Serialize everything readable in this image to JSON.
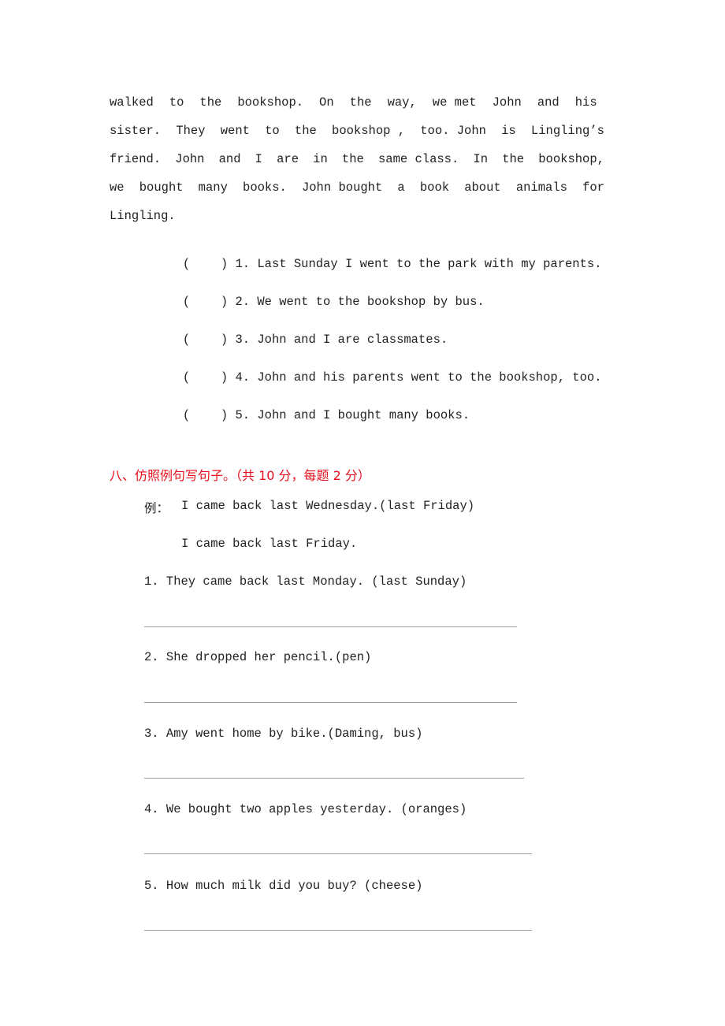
{
  "passage": {
    "lines": [
      [
        "walked",
        "to",
        "the",
        "bookshop.",
        "On",
        "the",
        "way,",
        "we met",
        "John",
        "and",
        "his "
      ],
      [
        "sister.",
        "They",
        "went",
        "to",
        "the",
        "bookshop ,",
        "too. John",
        "is",
        "Lingling’s"
      ],
      [
        "friend.",
        "John",
        "and",
        "I",
        "are",
        "in",
        "the",
        "same class.",
        "In",
        "the",
        "bookshop,"
      ],
      [
        "we",
        "bought",
        "many",
        "books.",
        "John bought",
        "a",
        "book",
        "about",
        "animals",
        "for"
      ]
    ],
    "last_line": "Lingling."
  },
  "true_false": {
    "items": [
      {
        "blank": "(",
        "close": ")",
        "text": "1. Last Sunday I went to the park with my parents."
      },
      {
        "blank": "(",
        "close": ")",
        "text": "2. We went to the bookshop by bus."
      },
      {
        "blank": "(",
        "close": ")",
        "text": "3. John and I are classmates."
      },
      {
        "blank": "(",
        "close": ")",
        "text": "4. John and his parents went to the bookshop, too."
      },
      {
        "blank": "(",
        "close": ")",
        "text": "5. John and I bought many books."
      }
    ]
  },
  "section8": {
    "heading": "八、仿照例句写句子。（共 10 分，每题 2 分）",
    "heading_color": "#e8101c",
    "example_label": "例：",
    "example_sentence": "I came back last Wednesday.(last Friday)",
    "example_answer": "I came back last Friday.",
    "questions": [
      "1. They came back last Monday. (last Sunday)",
      "2. She dropped her pencil.(pen)",
      "3. Amy went home by bike.(Daming, bus)",
      "4. We bought two apples yesterday. (oranges)",
      "5. How much milk did you buy? (cheese)"
    ]
  }
}
